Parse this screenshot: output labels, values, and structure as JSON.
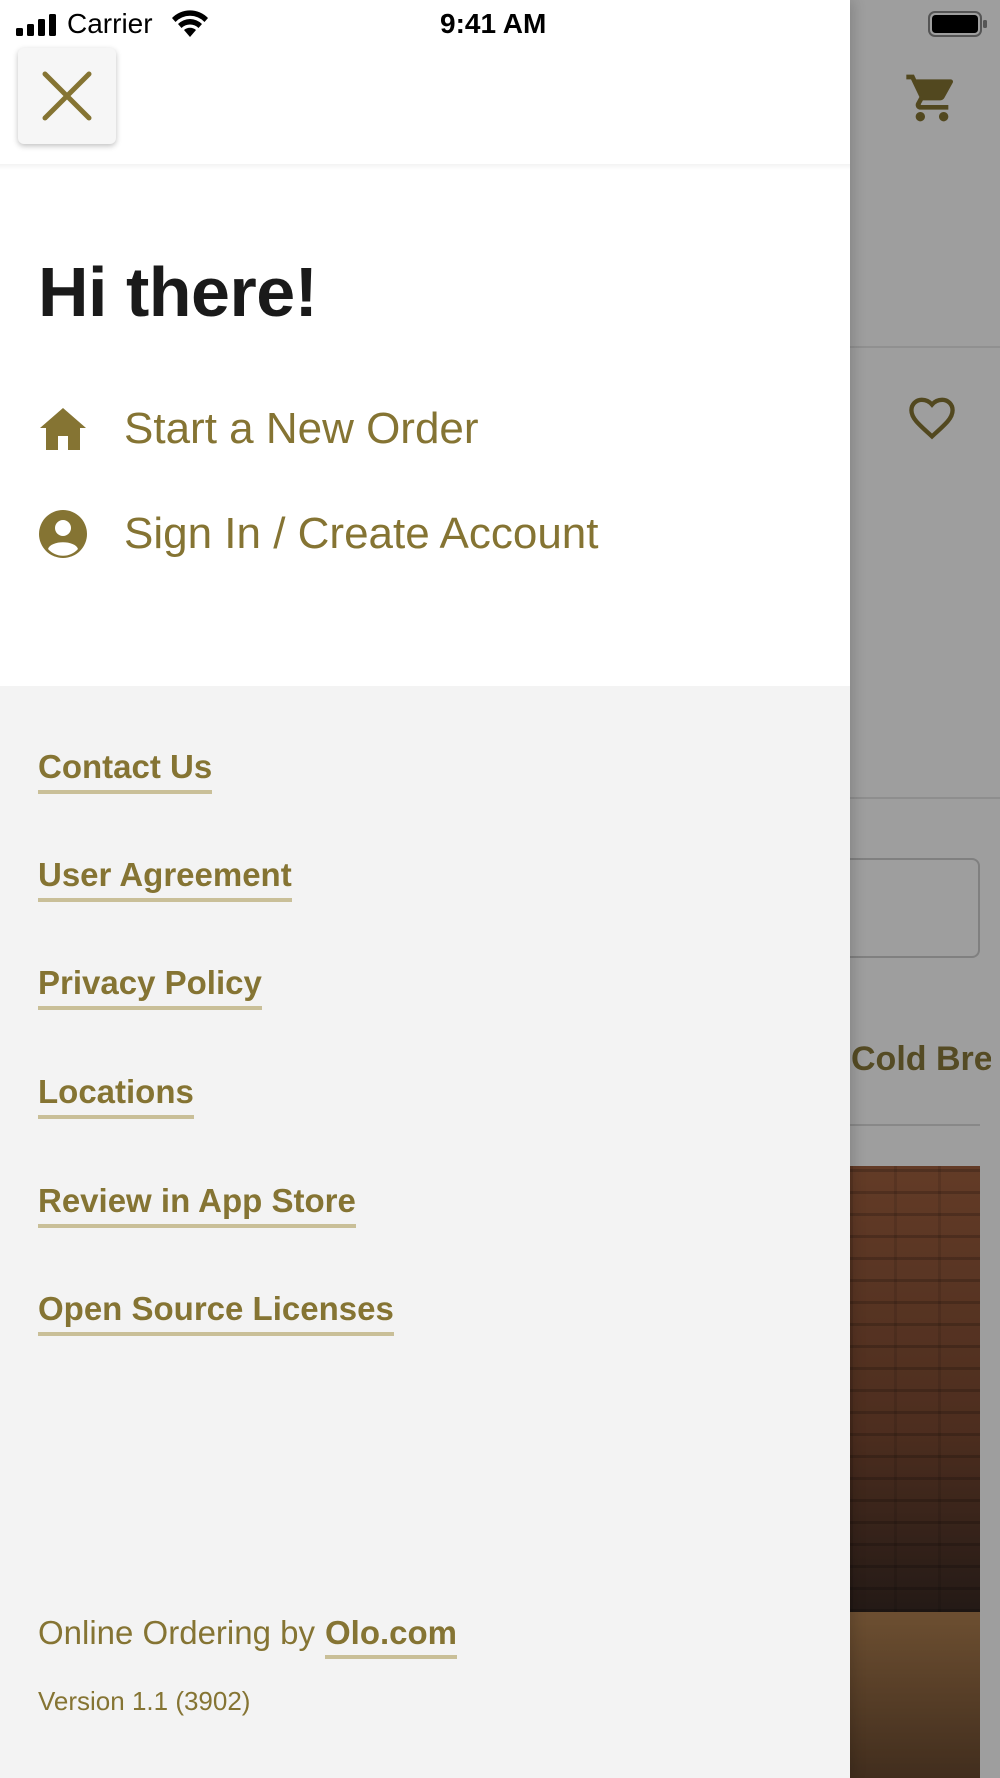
{
  "status_bar": {
    "carrier": "Carrier",
    "time": "9:41 AM"
  },
  "colors": {
    "accent": "#857433",
    "underline": "#c9bf98",
    "drawer_bottom": "#f3f3f3"
  },
  "drawer": {
    "greeting": "Hi there!",
    "menu": [
      {
        "label": "Start a New Order",
        "icon": "home-icon"
      },
      {
        "label": "Sign In / Create Account",
        "icon": "user-circle-icon"
      }
    ],
    "links": [
      "Contact Us",
      "User Agreement",
      "Privacy Policy",
      "Locations",
      "Review in App Store",
      "Open Source Licenses"
    ],
    "footer": {
      "prefix": "Online Ordering by",
      "link": "Olo.com",
      "version": "Version 1.1 (3902)"
    }
  },
  "background": {
    "tab_label": "Cold Bre",
    "icons": [
      "cart-icon",
      "heart-icon"
    ]
  }
}
